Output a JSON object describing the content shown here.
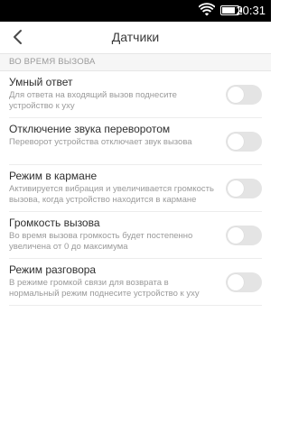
{
  "status_bar": {
    "time": "20:31",
    "wifi_icon": "wifi-icon",
    "battery_icon": "battery-icon",
    "battery_level": 0.85
  },
  "header": {
    "back_icon": "chevron-left-icon",
    "title": "Датчики"
  },
  "section": {
    "title": "ВО ВРЕМЯ ВЫЗОВА"
  },
  "settings": [
    {
      "label": "Умный ответ",
      "description": "Для ответа на входящий вызов поднесите устройство к уху",
      "enabled": false
    },
    {
      "label": "Отключение звука переворотом",
      "description": "Переворот устройства отключает звук вызова",
      "enabled": false
    },
    {
      "label": "Режим в кармане",
      "description": "Активируется вибрация и увеличивается громкость вызова, когда устройство находится в кармане",
      "enabled": false
    },
    {
      "label": "Громкость вызова",
      "description": "Во время вызова громкость будет постепенно увеличена от 0 до максимума",
      "enabled": false
    },
    {
      "label": "Режим разговора",
      "description": "В режиме громкой связи для возврата в нормальный режим поднесите устройство к уху",
      "enabled": false
    }
  ],
  "colors": {
    "status_bar_bg": "#000000",
    "toggle_off": "#e4e4e4",
    "section_bg": "#f6f6f6"
  }
}
